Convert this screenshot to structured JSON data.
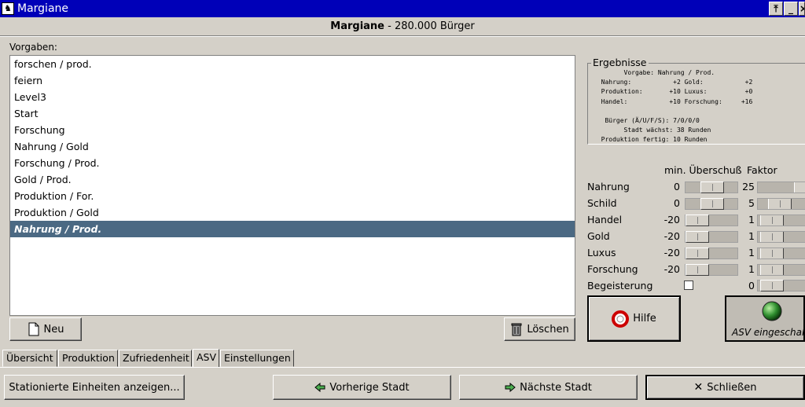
{
  "window": {
    "title": "Margiane",
    "app_icon": "app-icon",
    "controls": [
      "pin-icon",
      "minimize-icon",
      "close-icon"
    ]
  },
  "city": {
    "name": "Margiane",
    "population": "- 280.000 Bürger"
  },
  "presets": {
    "label": "Vorgaben:",
    "items": [
      "forschen / prod.",
      "feiern",
      "Level3",
      "Start",
      "Forschung",
      "Nahrung / Gold",
      "Forschung / Prod.",
      "Gold / Prod.",
      "Produktion / For.",
      "Produktion / Gold",
      "Nahrung / Prod."
    ],
    "selected_index": 10,
    "new_button": "Neu",
    "delete_button": "Löschen"
  },
  "results": {
    "title": "Ergebnisse",
    "text": "        Vorgabe: Nahrung / Prod.\n  Nahrung:           +2 Gold:           +2\n  Produktion:       +10 Luxus:          +0\n  Handel:           +10 Forschung:     +16\n\n   Bürger (Ä/U/F/S): 7/0/0/0\n        Stadt wächst: 38 Runden\n  Produktion fertig: 10 Runden"
  },
  "params": {
    "header_min": "min. Überschuß",
    "header_factor": "Faktor",
    "rows": [
      {
        "label": "Nahrung",
        "min": "0",
        "min_pos": 0.5,
        "factor": "25",
        "factor_pos": 0.9
      },
      {
        "label": "Schild",
        "min": "0",
        "min_pos": 0.5,
        "factor": "5",
        "factor_pos": 0.2
      },
      {
        "label": "Handel",
        "min": "-20",
        "min_pos": 0.0,
        "factor": "1",
        "factor_pos": 0.0
      },
      {
        "label": "Gold",
        "min": "-20",
        "min_pos": 0.0,
        "factor": "1",
        "factor_pos": 0.0
      },
      {
        "label": "Luxus",
        "min": "-20",
        "min_pos": 0.0,
        "factor": "1",
        "factor_pos": 0.0
      },
      {
        "label": "Forschung",
        "min": "-20",
        "min_pos": 0.0,
        "factor": "1",
        "factor_pos": 0.0
      }
    ],
    "enthusiasm_label": "Begeisterung",
    "enthusiasm_checked": false,
    "enthusiasm_factor": "0",
    "enthusiasm_factor_pos": 0.0
  },
  "help_button": "Hilfe",
  "asv_button": "ASV eingeschaltet",
  "tabs": [
    {
      "label": "Übersicht",
      "active": false
    },
    {
      "label": "Produktion",
      "active": false
    },
    {
      "label": "Zufriedenheit",
      "active": false
    },
    {
      "label": "ASV",
      "active": true
    },
    {
      "label": "Einstellungen",
      "active": false
    }
  ],
  "footer": {
    "units_button": "Stationierte Einheiten anzeigen...",
    "prev_button": "Vorherige Stadt",
    "next_button": "Nächste Stadt",
    "close_button": "Schließen"
  },
  "colors": {
    "titlebar": "#0000b8",
    "selection": "#4b6983",
    "asv_light": "#2f8f2f"
  }
}
